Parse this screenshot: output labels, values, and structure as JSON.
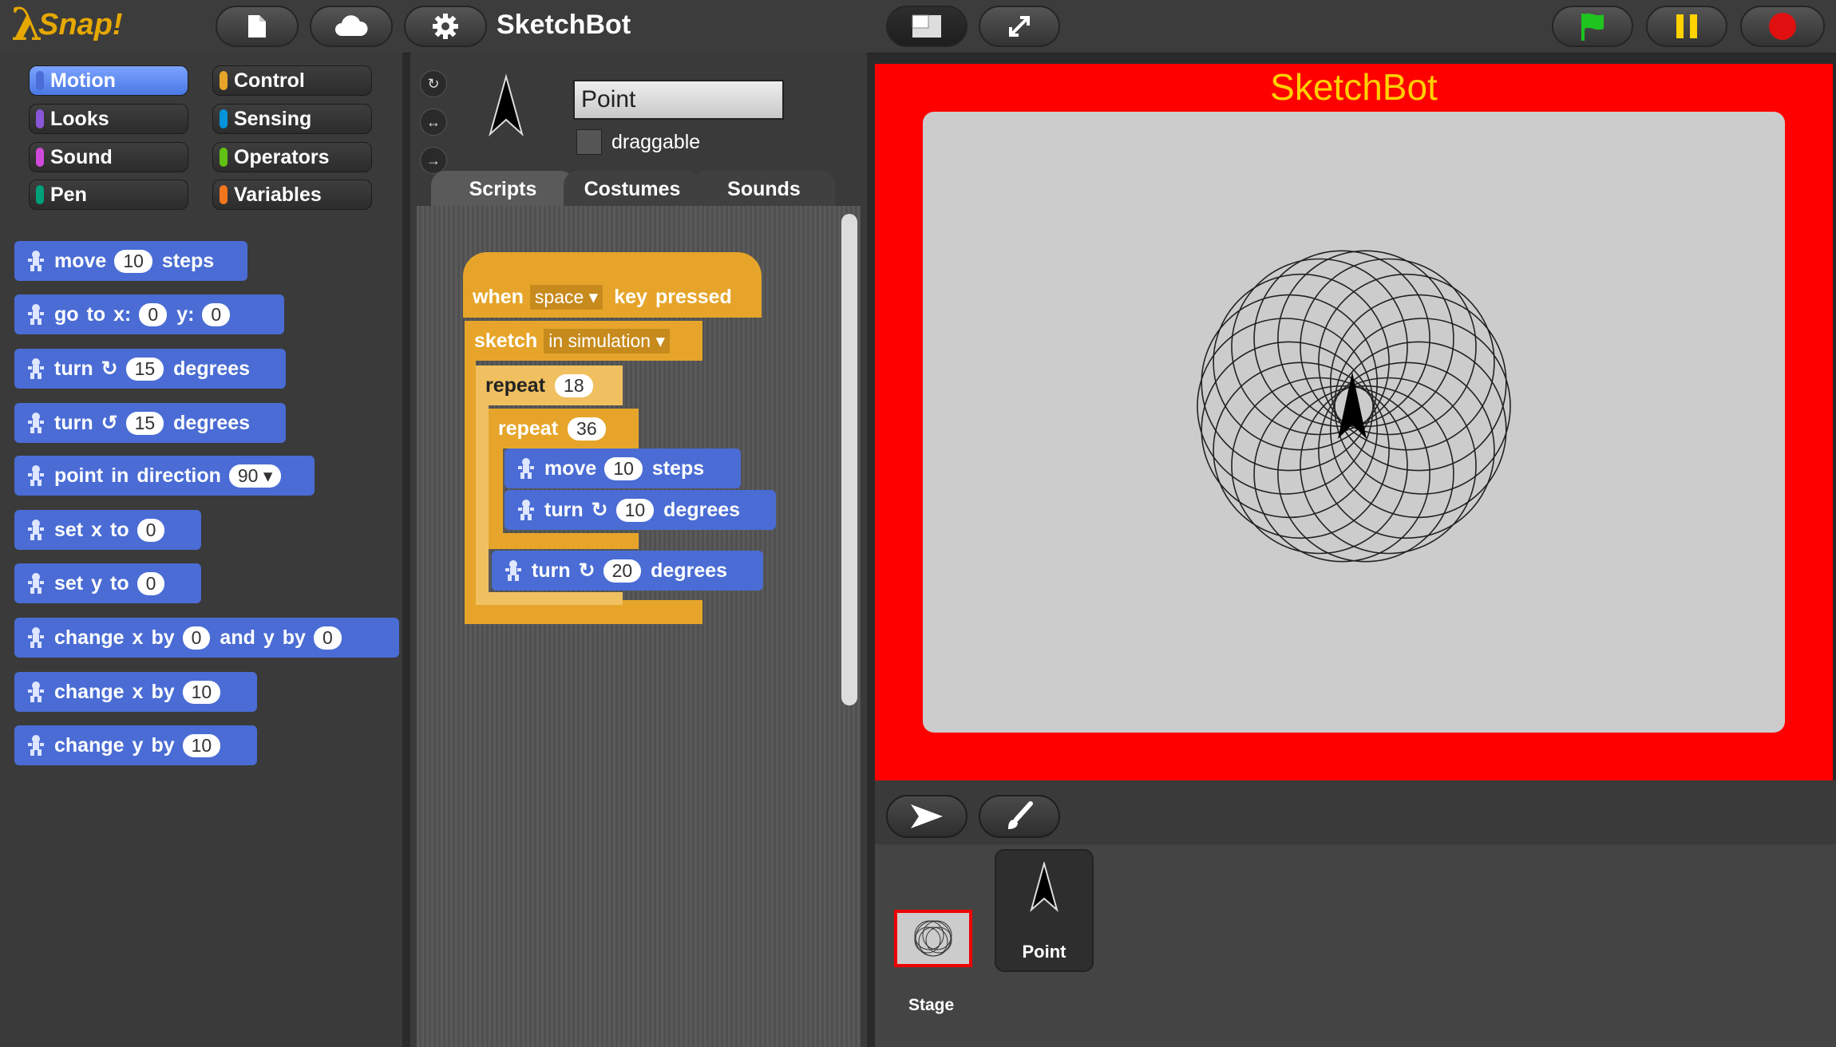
{
  "app": {
    "logo_text": "Snap!",
    "project_title": "SketchBot"
  },
  "toolbar": {
    "file_icon": "file-icon",
    "cloud_icon": "cloud-icon",
    "settings_icon": "gear-icon",
    "stage_size_icon": "stage-size-icon",
    "fullscreen_icon": "fullscreen-icon",
    "go_icon": "green-flag-icon",
    "pause_icon": "pause-icon",
    "stop_icon": "stop-icon",
    "colors": {
      "flag": "#1fc41f",
      "pause": "#ffd200",
      "stop": "#e01010"
    }
  },
  "categories": [
    {
      "label": "Motion",
      "color": "#4a6cd4",
      "selected": true
    },
    {
      "label": "Control",
      "color": "#e6a52a"
    },
    {
      "label": "Looks",
      "color": "#8a55d7"
    },
    {
      "label": "Sensing",
      "color": "#0494dc"
    },
    {
      "label": "Sound",
      "color": "#cf4ad9"
    },
    {
      "label": "Operators",
      "color": "#62c213"
    },
    {
      "label": "Pen",
      "color": "#00a178"
    },
    {
      "label": "Variables",
      "color": "#f3761d"
    }
  ],
  "palette": {
    "move": {
      "w1": "move",
      "n1": "10",
      "w2": "steps"
    },
    "goto": {
      "w1": "go",
      "w2": "to",
      "w3": "x:",
      "n1": "0",
      "w4": "y:",
      "n2": "0"
    },
    "turn_cw": {
      "w1": "turn",
      "n1": "15",
      "w2": "degrees"
    },
    "turn_ccw": {
      "w1": "turn",
      "n1": "15",
      "w2": "degrees"
    },
    "point_dir": {
      "w1": "point",
      "w2": "in",
      "w3": "direction",
      "n1": "90"
    },
    "setx": {
      "w1": "set",
      "w2": "x",
      "w3": "to",
      "n1": "0"
    },
    "sety": {
      "w1": "set",
      "w2": "y",
      "w3": "to",
      "n1": "0"
    },
    "changexy": {
      "w1": "change",
      "w2": "x",
      "w3": "by",
      "n1": "0",
      "w4": "and",
      "w5": "y",
      "w6": "by",
      "n2": "0"
    },
    "changex": {
      "w1": "change",
      "w2": "x",
      "w3": "by",
      "n1": "10"
    },
    "changey": {
      "w1": "change",
      "w2": "y",
      "w3": "by",
      "n1": "10"
    }
  },
  "sprite": {
    "name": "Point",
    "draggable_label": "draggable",
    "draggable": false
  },
  "tabs": [
    {
      "label": "Scripts",
      "selected": true
    },
    {
      "label": "Costumes"
    },
    {
      "label": "Sounds"
    }
  ],
  "script": {
    "hat": {
      "w1": "when",
      "key": "space",
      "w2": "key",
      "w3": "pressed"
    },
    "sketch": {
      "w1": "sketch",
      "mode": "in simulation"
    },
    "repeat_outer": {
      "w1": "repeat",
      "n1": "18"
    },
    "repeat_inner": {
      "w1": "repeat",
      "n1": "36"
    },
    "move": {
      "w1": "move",
      "n1": "10",
      "w2": "steps"
    },
    "turn_inner": {
      "w1": "turn",
      "n1": "10",
      "w2": "degrees"
    },
    "turn_outer": {
      "w1": "turn",
      "n1": "20",
      "w2": "degrees"
    }
  },
  "stage": {
    "title": "SketchBot",
    "background": "#ff0000",
    "canvas_color": "#cccccc",
    "circle_count": 18,
    "turn_step_degrees": 20
  },
  "corral": {
    "new_turtle_icon": "turtle-arrow-icon",
    "paint_icon": "paintbrush-icon",
    "stage_label": "Stage",
    "sprite_label": "Point"
  }
}
